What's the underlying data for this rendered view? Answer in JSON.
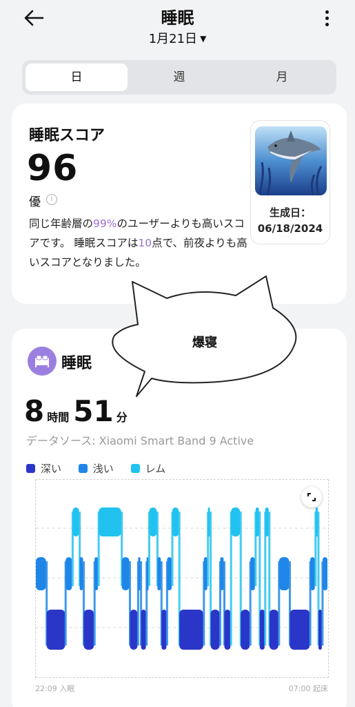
{
  "header": {
    "title": "睡眠",
    "date": "1月21日"
  },
  "tabs": [
    {
      "label": "日"
    },
    {
      "label": "週"
    },
    {
      "label": "月"
    }
  ],
  "score_card": {
    "title": "睡眠スコア",
    "value": "96",
    "grade": "優",
    "desc_part1": "同じ年齢層の",
    "desc_pct": "99%",
    "desc_part2": "のユーザーよりも高いスコアです。 睡眠スコアは",
    "desc_points": "10",
    "desc_part3": "点で、前夜よりも高いスコアとなりました。",
    "badge_label": "生成日：",
    "badge_date": "06/18/2024"
  },
  "speech_bubble": "爆寝",
  "sleep_card": {
    "title": "睡眠",
    "hours": "8",
    "hours_unit": "時間",
    "minutes": "51",
    "minutes_unit": "分",
    "source": "データソース: Xiaomi Smart Band 9 Active",
    "legend": [
      {
        "label": "深い",
        "color": "#2a36c8"
      },
      {
        "label": "浅い",
        "color": "#1f86e8"
      },
      {
        "label": "レム",
        "color": "#22c2f0"
      }
    ],
    "start_label": "22:09 入眠",
    "end_label": "07:00 起床"
  },
  "colors": {
    "deep": "#2a36c8",
    "light": "#1f86e8",
    "rem": "#22c2f0",
    "accent": "#9b6fd6"
  },
  "chart_data": {
    "type": "area",
    "title": "",
    "stages": [
      "深い",
      "浅い",
      "レム"
    ],
    "x_start": "22:09",
    "x_end": "07:00",
    "segments": [
      {
        "stage": "浅い",
        "start": 0.0,
        "end": 0.037
      },
      {
        "stage": "深い",
        "start": 0.037,
        "end": 0.102
      },
      {
        "stage": "浅い",
        "start": 0.102,
        "end": 0.126
      },
      {
        "stage": "レム",
        "start": 0.126,
        "end": 0.15
      },
      {
        "stage": "浅い",
        "start": 0.15,
        "end": 0.164
      },
      {
        "stage": "深い",
        "start": 0.164,
        "end": 0.201
      },
      {
        "stage": "浅い",
        "start": 0.201,
        "end": 0.215
      },
      {
        "stage": "レム",
        "start": 0.215,
        "end": 0.294
      },
      {
        "stage": "浅い",
        "start": 0.294,
        "end": 0.322
      },
      {
        "stage": "深い",
        "start": 0.322,
        "end": 0.35
      },
      {
        "stage": "浅い",
        "start": 0.35,
        "end": 0.36
      },
      {
        "stage": "深い",
        "start": 0.36,
        "end": 0.379
      },
      {
        "stage": "浅い",
        "start": 0.379,
        "end": 0.388
      },
      {
        "stage": "レム",
        "start": 0.388,
        "end": 0.416
      },
      {
        "stage": "浅い",
        "start": 0.416,
        "end": 0.43
      },
      {
        "stage": "深い",
        "start": 0.43,
        "end": 0.449
      },
      {
        "stage": "浅い",
        "start": 0.449,
        "end": 0.467
      },
      {
        "stage": "レム",
        "start": 0.467,
        "end": 0.491
      },
      {
        "stage": "深い",
        "start": 0.491,
        "end": 0.575
      },
      {
        "stage": "浅い",
        "start": 0.575,
        "end": 0.589
      },
      {
        "stage": "レム",
        "start": 0.589,
        "end": 0.598
      },
      {
        "stage": "深い",
        "start": 0.598,
        "end": 0.631
      },
      {
        "stage": "浅い",
        "start": 0.631,
        "end": 0.645
      },
      {
        "stage": "深い",
        "start": 0.645,
        "end": 0.668
      },
      {
        "stage": "レム",
        "start": 0.668,
        "end": 0.701
      },
      {
        "stage": "深い",
        "start": 0.701,
        "end": 0.734
      },
      {
        "stage": "浅い",
        "start": 0.734,
        "end": 0.752
      },
      {
        "stage": "レム",
        "start": 0.752,
        "end": 0.766
      },
      {
        "stage": "深い",
        "start": 0.766,
        "end": 0.785
      },
      {
        "stage": "レム",
        "start": 0.785,
        "end": 0.799
      },
      {
        "stage": "深い",
        "start": 0.799,
        "end": 0.832
      },
      {
        "stage": "浅い",
        "start": 0.832,
        "end": 0.869
      },
      {
        "stage": "深い",
        "start": 0.869,
        "end": 0.939
      },
      {
        "stage": "浅い",
        "start": 0.939,
        "end": 0.957
      },
      {
        "stage": "レム",
        "start": 0.957,
        "end": 0.967
      },
      {
        "stage": "深い",
        "start": 0.967,
        "end": 0.981
      },
      {
        "stage": "浅い",
        "start": 0.981,
        "end": 1.0
      }
    ]
  }
}
